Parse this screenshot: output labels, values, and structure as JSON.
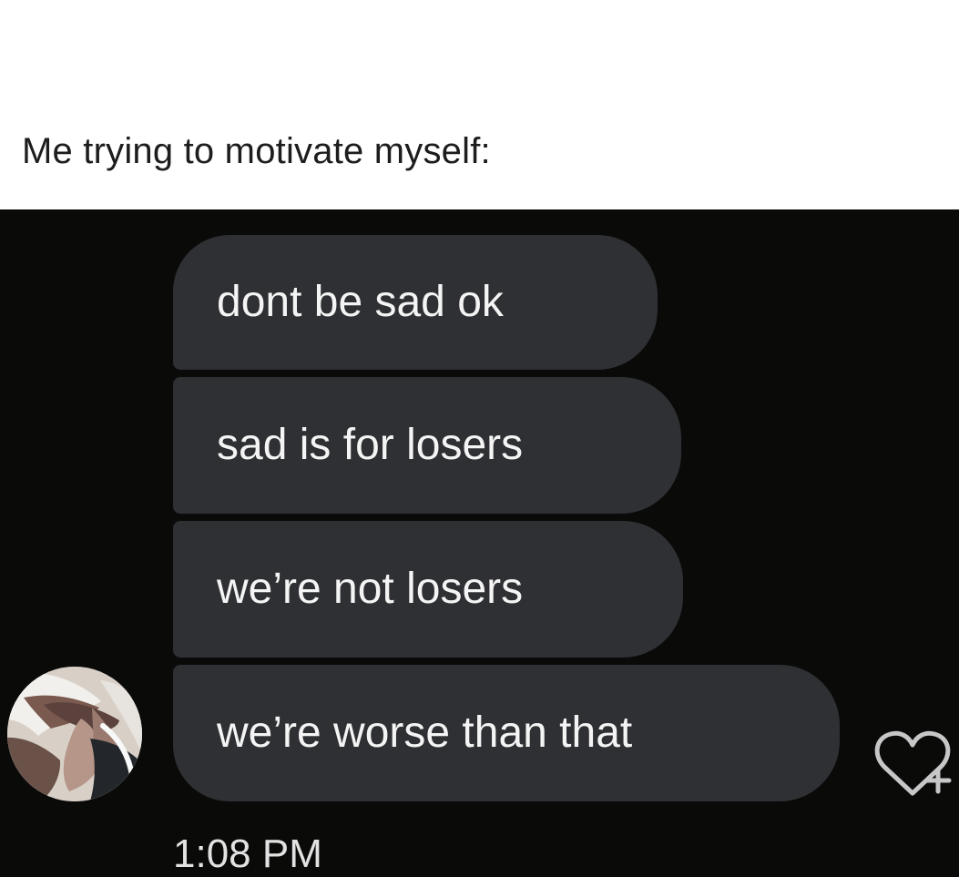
{
  "caption": "Me trying to motivate myself:",
  "messages": [
    {
      "text": "dont be sad ok"
    },
    {
      "text": "sad is for losers"
    },
    {
      "text": "we’re not losers"
    },
    {
      "text": "we’re worse than that"
    }
  ],
  "timestamp": "1:08 PM",
  "icons": {
    "avatar": "avatar",
    "reaction": "heart-plus-icon"
  },
  "colors": {
    "chat_background": "#0a0a09",
    "bubble": "#2f3033",
    "bubble_text": "#f4f4f4"
  }
}
